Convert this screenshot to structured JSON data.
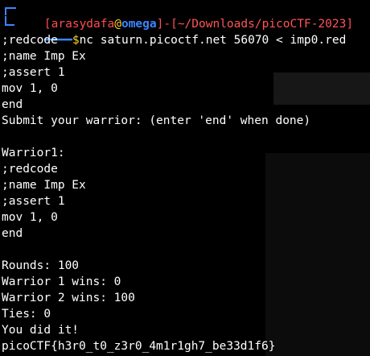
{
  "prompt": {
    "open_bracket": "[",
    "user": "arasydafa",
    "at": "@",
    "host": "omega",
    "mid": "]-[",
    "path": "~/Downloads/picoCTF-2023",
    "close_bracket": "]",
    "dollar": "$",
    "command": "nc saturn.picoctf.net 56070 < imp0.red"
  },
  "output_lines": [
    ";redcode",
    ";name Imp Ex",
    ";assert 1",
    "mov 1, 0",
    "end",
    "Submit your warrior: (enter 'end' when done)",
    "",
    "Warrior1:",
    ";redcode",
    ";name Imp Ex",
    ";assert 1",
    "mov 1, 0",
    "end",
    "",
    "Rounds: 100",
    "Warrior 1 wins: 0",
    "Warrior 2 wins: 100",
    "Ties: 0",
    "You did it!",
    "picoCTF{h3r0_t0_z3r0_4m1r1gh7_be33d1f6}"
  ],
  "colors": {
    "prompt_frame": "#3a86ff",
    "user": "#ff4d4d",
    "at": "#ffd21f",
    "host": "#3a86ff",
    "path": "#ff4d4d",
    "dollar": "#ffd21f",
    "text": "#ffffff",
    "background": "#000000"
  }
}
